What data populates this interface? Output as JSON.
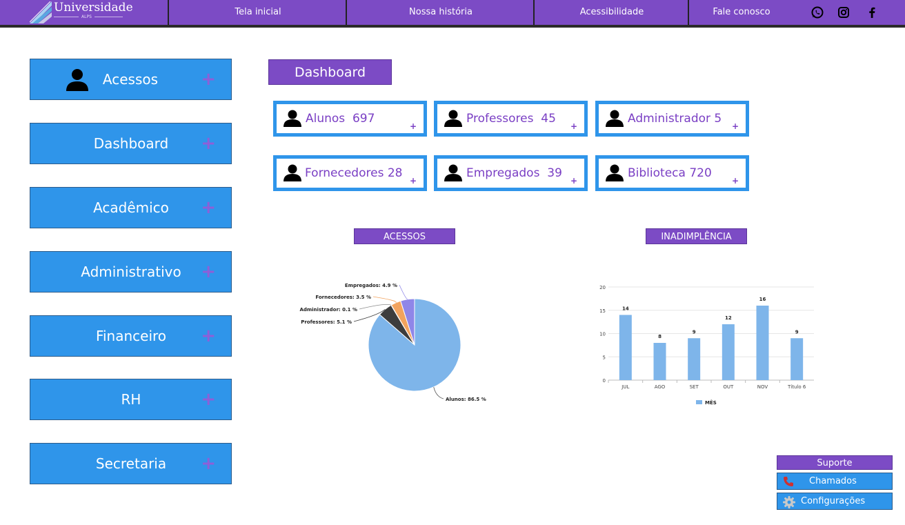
{
  "header": {
    "logo_text": "Universidade",
    "logo_sub": "ALPS",
    "nav": [
      "Tela inicial",
      "Nossa história",
      "Acessibilidade",
      "Fale conosco"
    ],
    "social_icons": [
      "whatsapp-icon",
      "instagram-icon",
      "facebook-icon"
    ]
  },
  "sidebar": {
    "items": [
      {
        "label": "Acessos",
        "icon": "user-icon"
      },
      {
        "label": "Dashboard"
      },
      {
        "label": "Acadêmico"
      },
      {
        "label": "Administrativo"
      },
      {
        "label": "Financeiro"
      },
      {
        "label": "RH"
      },
      {
        "label": "Secretaria"
      }
    ],
    "plus": "+"
  },
  "dashboard": {
    "title": "Dashboard",
    "cards": [
      {
        "label": "Alunos",
        "count": "697"
      },
      {
        "label": "Professores",
        "count": "45"
      },
      {
        "label": "Administrador",
        "count": "5"
      },
      {
        "label": "Fornecedores",
        "count": "28"
      },
      {
        "label": "Empregados",
        "count": "39"
      },
      {
        "label": "Biblioteca",
        "count": "720"
      }
    ],
    "card_plus": "+"
  },
  "charts": {
    "pie_title": "ACESSOS",
    "bar_title": "INADIMPLÊNCIA"
  },
  "chart_data": [
    {
      "type": "pie",
      "labels": [
        "Alunos",
        "Professores",
        "Administrador",
        "Fornecedores",
        "Empregados"
      ],
      "values": [
        86.5,
        5.1,
        0.1,
        3.5,
        4.9
      ],
      "display_labels": [
        "Alunos: 86.5 %",
        "Professores: 5.1 %",
        "Administrador: 0.1 %",
        "Fornecedores: 3.5 %",
        "Empregados: 4.9 %"
      ],
      "colors": [
        "#7eb5ea",
        "#3d3d3d",
        "#8c8c8c",
        "#f2a35e",
        "#8f86e8"
      ]
    },
    {
      "type": "bar",
      "categories": [
        "JUL",
        "AGO",
        "SET",
        "OUT",
        "NOV",
        "Título 6"
      ],
      "series": [
        {
          "name": "MÊS",
          "values": [
            14,
            8,
            9,
            12,
            16,
            9
          ]
        }
      ],
      "yticks": [
        0,
        5,
        10,
        15,
        20
      ],
      "ylim": [
        0,
        20
      ],
      "color": "#7eb5ea",
      "legend_position": "bottom"
    }
  ],
  "support": {
    "title": "Suporte",
    "chamados": "Chamados",
    "config": "Configurações"
  },
  "colors": {
    "purple": "#7c4bc5",
    "blue": "#2f95ea",
    "card_text": "#7a3fc4"
  }
}
